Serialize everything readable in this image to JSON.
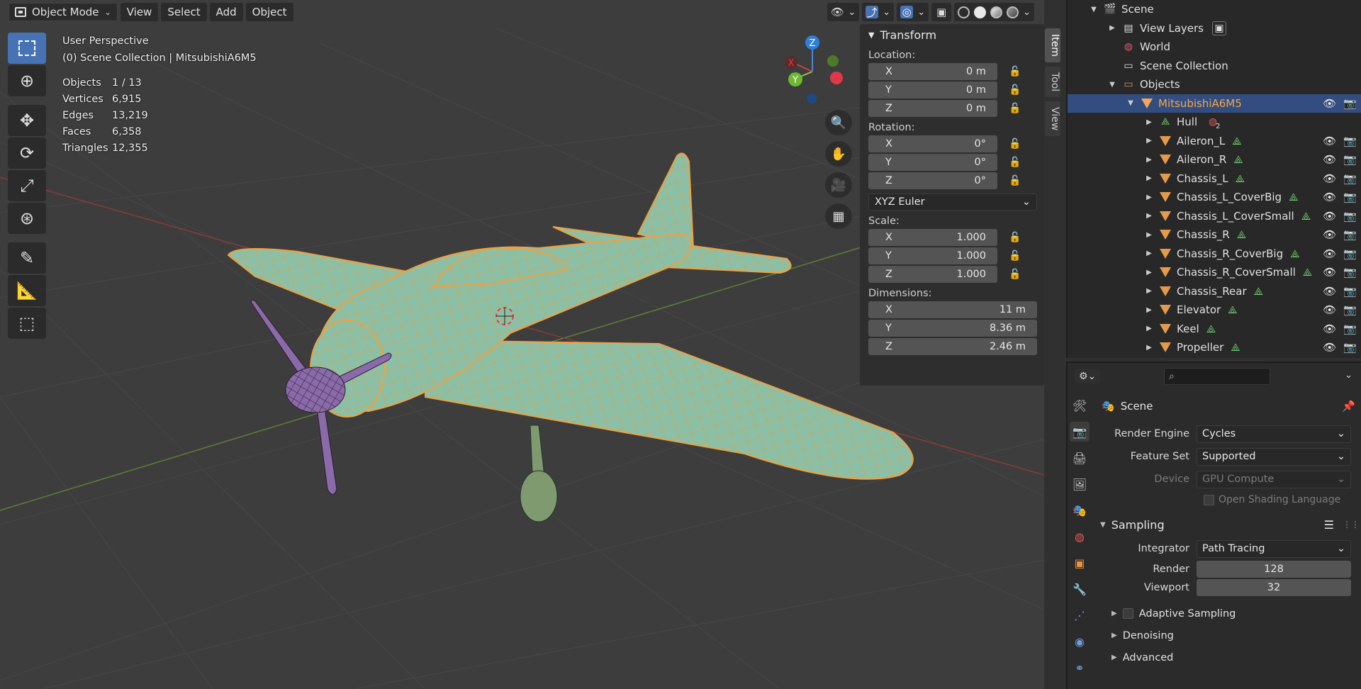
{
  "header": {
    "mode": "Object Mode",
    "menus": [
      "View",
      "Select",
      "Add",
      "Object"
    ]
  },
  "overlay": {
    "view_name": "User Perspective",
    "collection": "(0) Scene Collection | MitsubishiA6M5",
    "stats": [
      {
        "label": "Objects",
        "value": "1 / 13"
      },
      {
        "label": "Vertices",
        "value": "6,915"
      },
      {
        "label": "Edges",
        "value": "13,219"
      },
      {
        "label": "Faces",
        "value": "6,358"
      },
      {
        "label": "Triangles",
        "value": "12,355"
      }
    ]
  },
  "gizmo": {
    "x": "X",
    "y": "Y",
    "z": "Z"
  },
  "npanel": {
    "title": "Transform",
    "tabs": [
      "Item",
      "Tool",
      "View"
    ],
    "location_label": "Location:",
    "location": [
      {
        "axis": "X",
        "value": "0 m"
      },
      {
        "axis": "Y",
        "value": "0 m"
      },
      {
        "axis": "Z",
        "value": "0 m"
      }
    ],
    "rotation_label": "Rotation:",
    "rotation": [
      {
        "axis": "X",
        "value": "0°"
      },
      {
        "axis": "Y",
        "value": "0°"
      },
      {
        "axis": "Z",
        "value": "0°"
      }
    ],
    "rotation_mode": "XYZ Euler",
    "scale_label": "Scale:",
    "scale": [
      {
        "axis": "X",
        "value": "1.000"
      },
      {
        "axis": "Y",
        "value": "1.000"
      },
      {
        "axis": "Z",
        "value": "1.000"
      }
    ],
    "dimensions_label": "Dimensions:",
    "dimensions": [
      {
        "axis": "X",
        "value": "11 m"
      },
      {
        "axis": "Y",
        "value": "8.36 m"
      },
      {
        "axis": "Z",
        "value": "2.46 m"
      }
    ]
  },
  "outliner": {
    "scene": "Scene",
    "view_layers": "View Layers",
    "world": "World",
    "scene_collection": "Scene Collection",
    "objects": "Objects",
    "selected": "MitsubishiA6M5",
    "hull": "Hull",
    "hull_badge": "2",
    "children": [
      "Aileron_L",
      "Aileron_R",
      "Chassis_L",
      "Chassis_L_CoverBig",
      "Chassis_L_CoverSmall",
      "Chassis_R",
      "Chassis_R_CoverBig",
      "Chassis_R_CoverSmall",
      "Chassis_Rear",
      "Elevator",
      "Keel",
      "Propeller"
    ]
  },
  "properties": {
    "context": "Scene",
    "render_engine_label": "Render Engine",
    "render_engine": "Cycles",
    "feature_set_label": "Feature Set",
    "feature_set": "Supported",
    "device_label": "Device",
    "device": "GPU Compute",
    "osl_label": "Open Shading Language",
    "sampling_title": "Sampling",
    "integrator_label": "Integrator",
    "integrator": "Path Tracing",
    "render_label": "Render",
    "render_samples": "128",
    "viewport_label": "Viewport",
    "viewport_samples": "32",
    "adaptive_label": "Adaptive Sampling",
    "denoising_label": "Denoising",
    "advanced_label": "Advanced"
  },
  "colors": {
    "accent": "#4772b3",
    "selection": "#334d80",
    "object_orange": "#f5a64a",
    "mesh_green": "#6ed06e"
  }
}
